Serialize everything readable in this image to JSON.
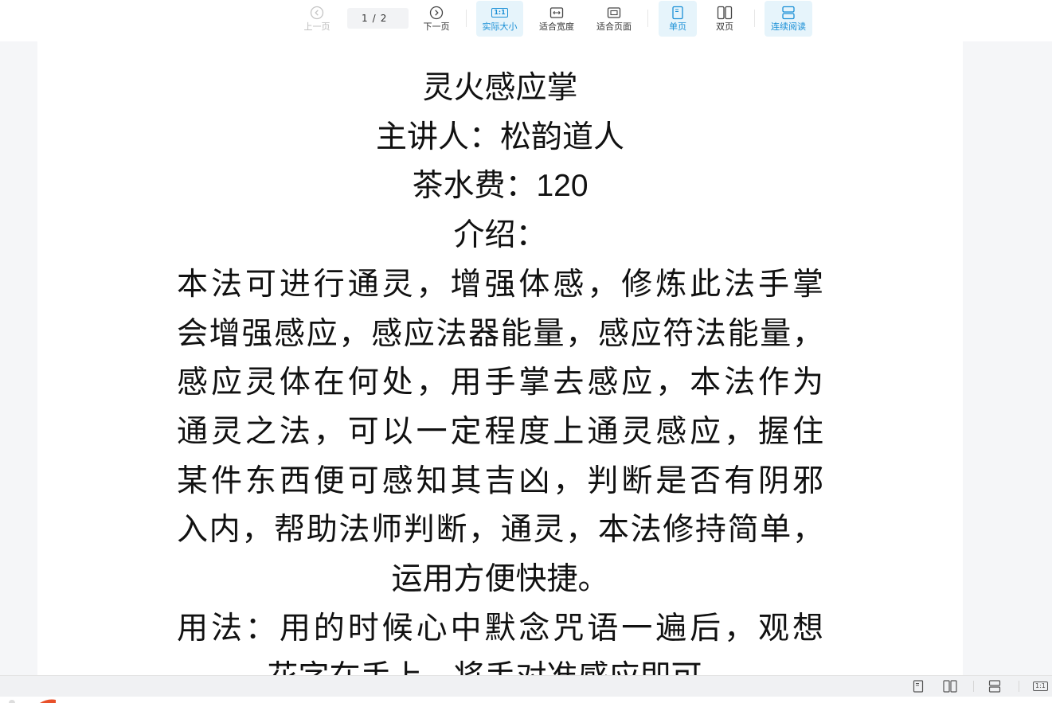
{
  "toolbar": {
    "prev_label": "上一页",
    "next_label": "下一页",
    "page_current": "1",
    "page_separator": "/",
    "page_total": "2",
    "actual_size_label": "实际大小",
    "actual_size_icon_text": "1:1",
    "fit_width_label": "适合宽度",
    "fit_page_label": "适合页面",
    "single_page_label": "单页",
    "double_page_label": "双页",
    "continuous_label": "连续阅读"
  },
  "document": {
    "title": "灵火感应掌",
    "speaker": "主讲人：松韵道人",
    "fee_label": "茶水费：",
    "fee_value": "120",
    "intro_heading": "介绍：",
    "intro_lines": [
      "本法可进行通灵，增强体感，修炼此法手掌",
      "会增强感应，感应法器能量，感应符法能量，",
      "感应灵体在何处，用手掌去感应，本法作为",
      "通灵之法，可以一定程度上通灵感应，握住",
      "某件东西便可感知其吉凶，判断是否有阴邪",
      "入内，帮助法师判断，通灵，本法修持简单，"
    ],
    "intro_last_line": "运用方便快捷。",
    "usage_line": "用法：用的时候心中默念咒语一遍后，观想",
    "usage_last_line": "花字在手上，将手对准感应即可。"
  },
  "statusbar": {
    "zoom_icon_text": "1:1"
  },
  "colors": {
    "accent": "#1a8fd6",
    "active_bg": "#e6f4fb",
    "toolbar_bg": "#ffffff",
    "viewer_bg": "#f5f6f8"
  }
}
